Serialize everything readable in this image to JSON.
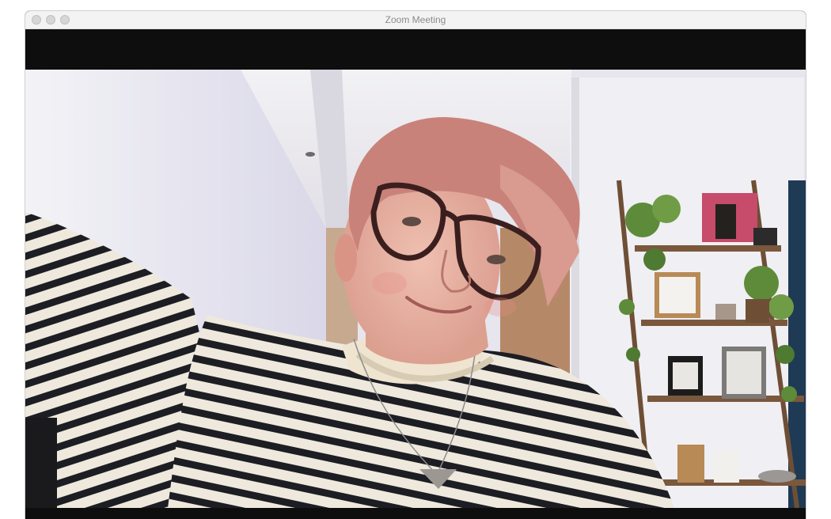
{
  "window": {
    "title": "Zoom Meeting"
  },
  "traffic_lights": [
    "close-button",
    "minimize-button",
    "zoom-button"
  ],
  "video": {
    "description_colors": {
      "wall": "#ecebf2",
      "shirt_stripe": "#1c1c22",
      "shirt_base": "#f1ebe0",
      "hair": "#c9847a",
      "skin": "#e4a89a"
    }
  }
}
